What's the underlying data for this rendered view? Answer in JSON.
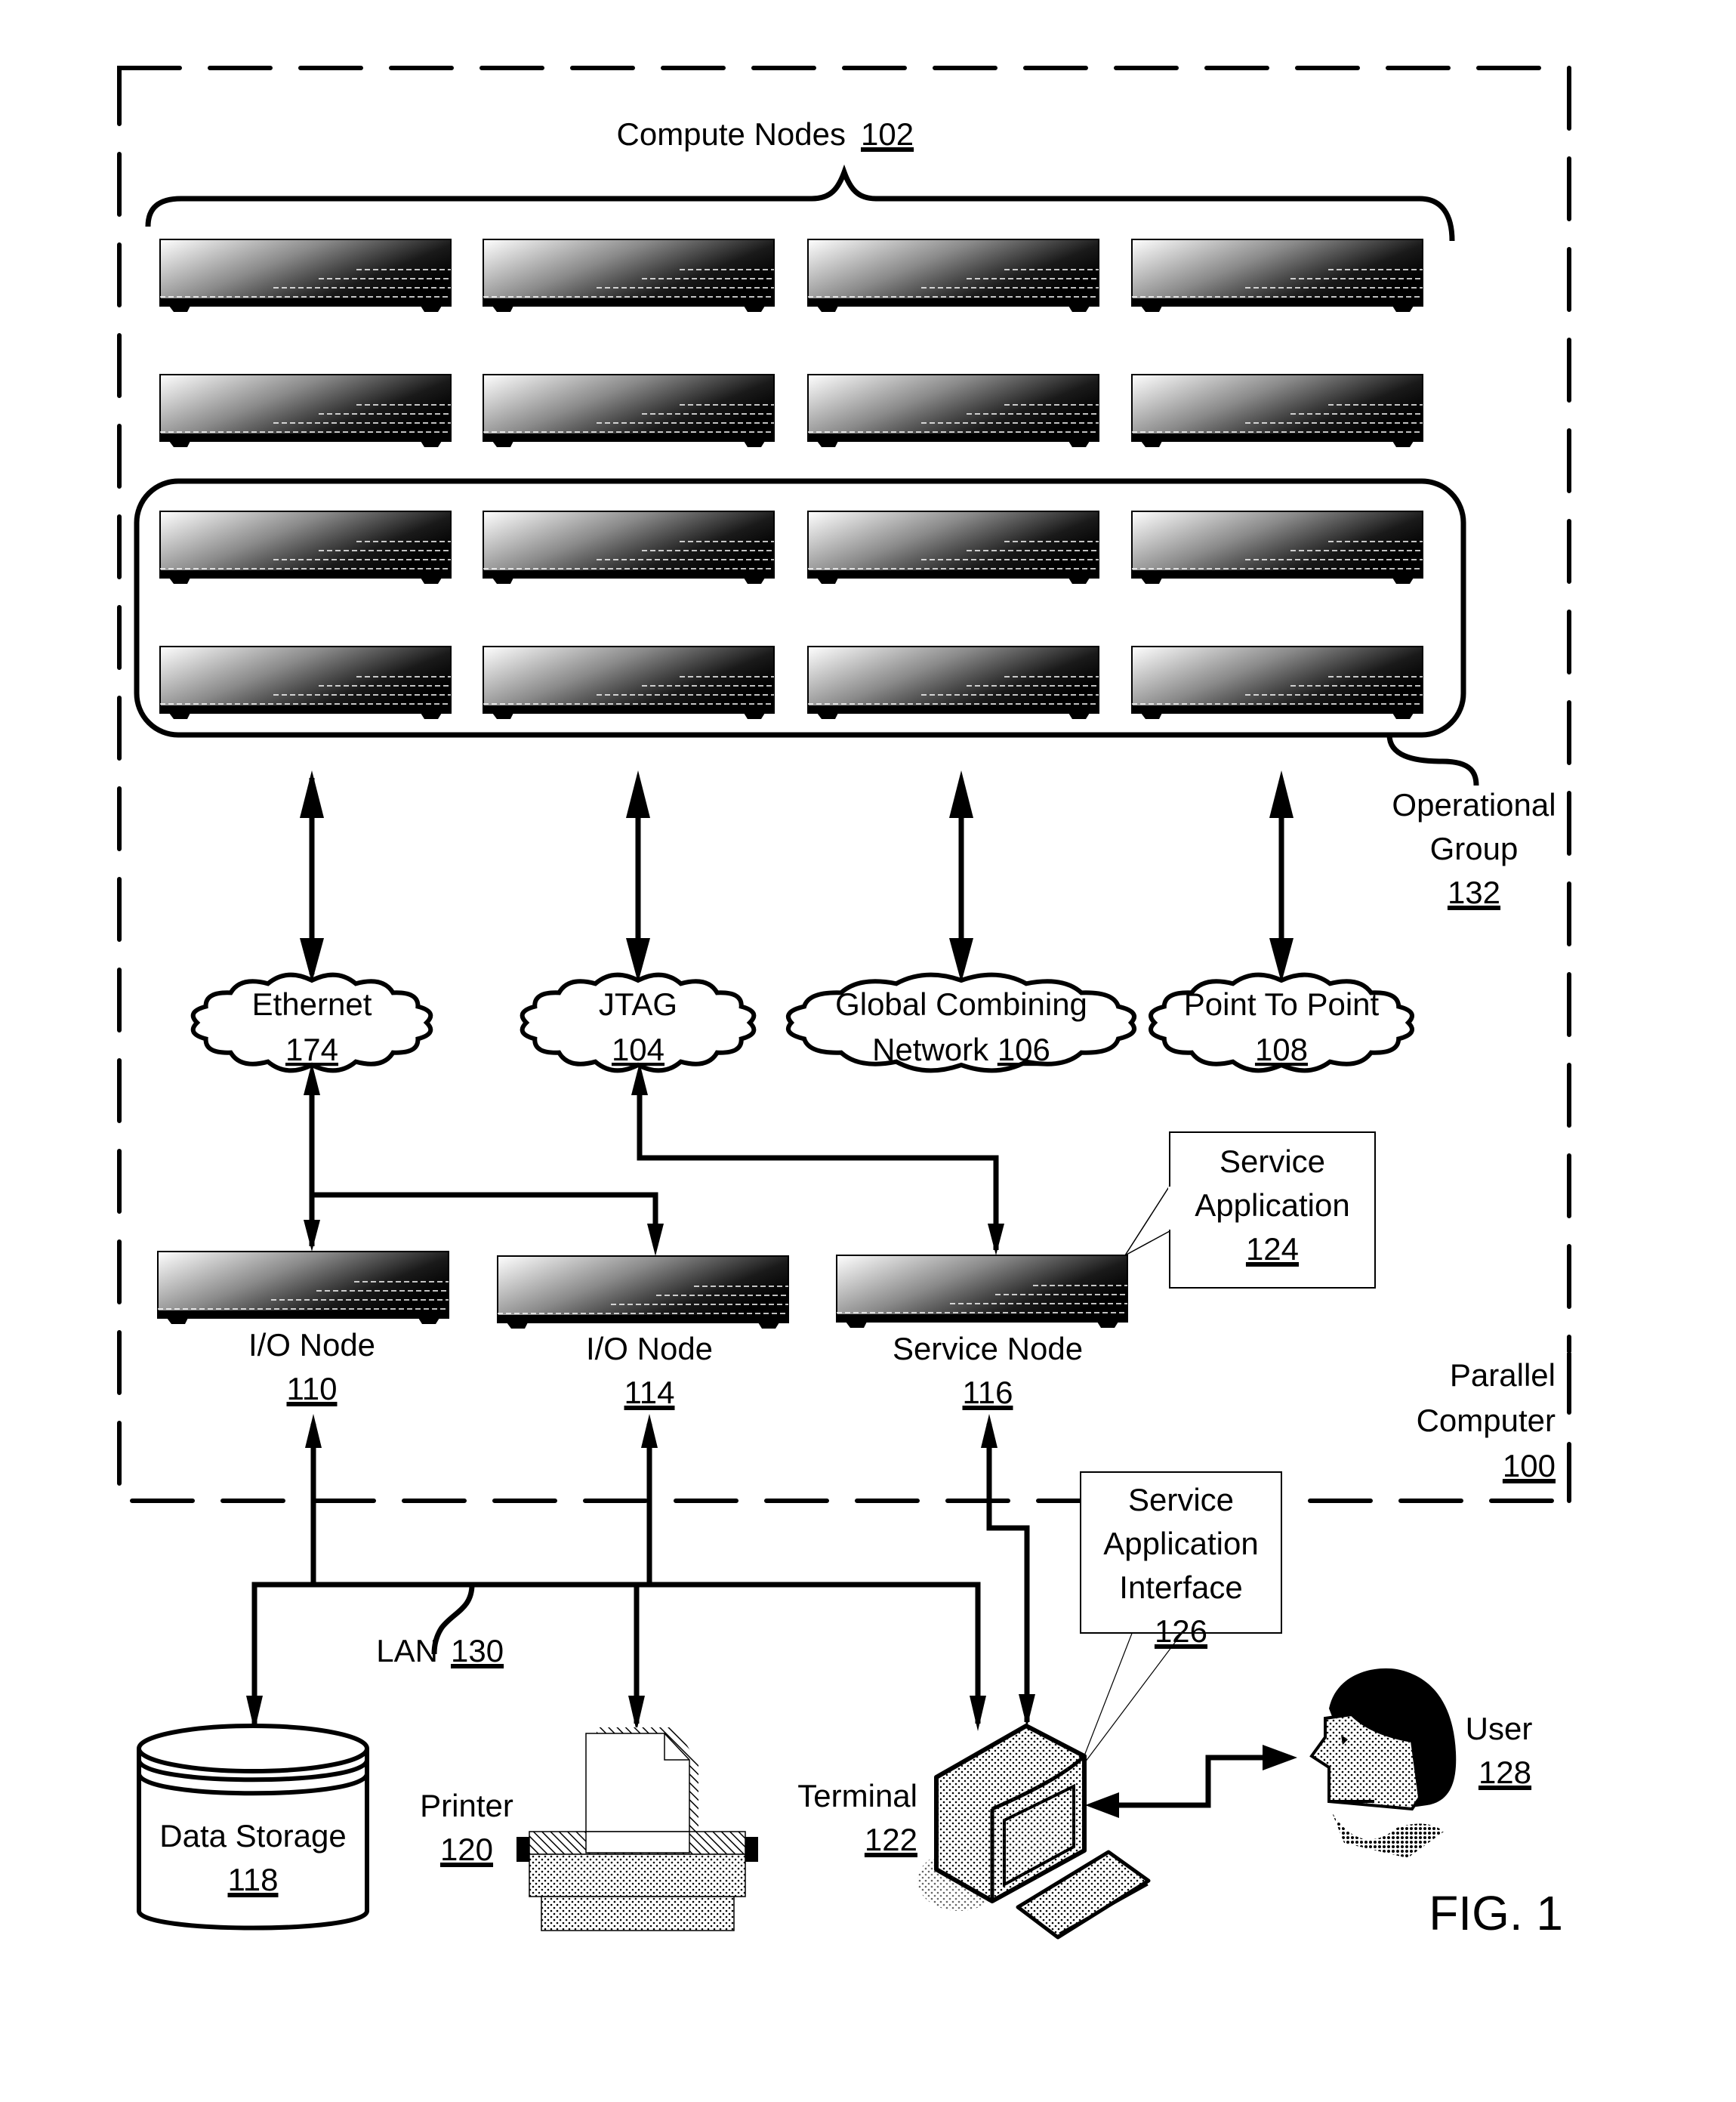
{
  "figure": {
    "label": "FIG. 1"
  },
  "parallel_computer": {
    "name_line1": "Parallel",
    "name_line2": "Computer",
    "ref": "100"
  },
  "compute_nodes": {
    "label": "Compute Nodes",
    "ref": "102",
    "rows": 4,
    "columns": 4
  },
  "operational_group": {
    "line1": "Operational",
    "line2": "Group",
    "ref": "132"
  },
  "networks": [
    {
      "line1": "Ethernet",
      "line2": "",
      "ref": "174",
      "icon": "cloud-icon"
    },
    {
      "line1": "JTAG",
      "line2": "",
      "ref": "104",
      "icon": "cloud-icon"
    },
    {
      "line1": "Global Combining",
      "line2": "Network",
      "ref": "106",
      "icon": "cloud-icon"
    },
    {
      "line1": "Point To Point",
      "line2": "",
      "ref": "108",
      "icon": "cloud-icon"
    }
  ],
  "io_nodes": [
    {
      "label": "I/O Node",
      "ref": "110",
      "icon": "server-icon"
    },
    {
      "label": "I/O Node",
      "ref": "114",
      "icon": "server-icon"
    }
  ],
  "service_node": {
    "label": "Service Node",
    "ref": "116",
    "icon": "server-icon"
  },
  "service_application": {
    "line1": "Service",
    "line2": "Application",
    "ref": "124"
  },
  "service_application_interface": {
    "line1": "Service",
    "line2": "Application",
    "line3": "Interface",
    "ref": "126"
  },
  "lan": {
    "label": "LAN",
    "ref": "130"
  },
  "data_storage": {
    "label": "Data Storage",
    "ref": "118",
    "icon": "database-icon"
  },
  "printer": {
    "label": "Printer",
    "ref": "120",
    "icon": "printer-icon"
  },
  "terminal": {
    "label": "Terminal",
    "ref": "122",
    "icon": "computer-terminal-icon"
  },
  "user": {
    "label": "User",
    "ref": "128",
    "icon": "user-icon"
  }
}
